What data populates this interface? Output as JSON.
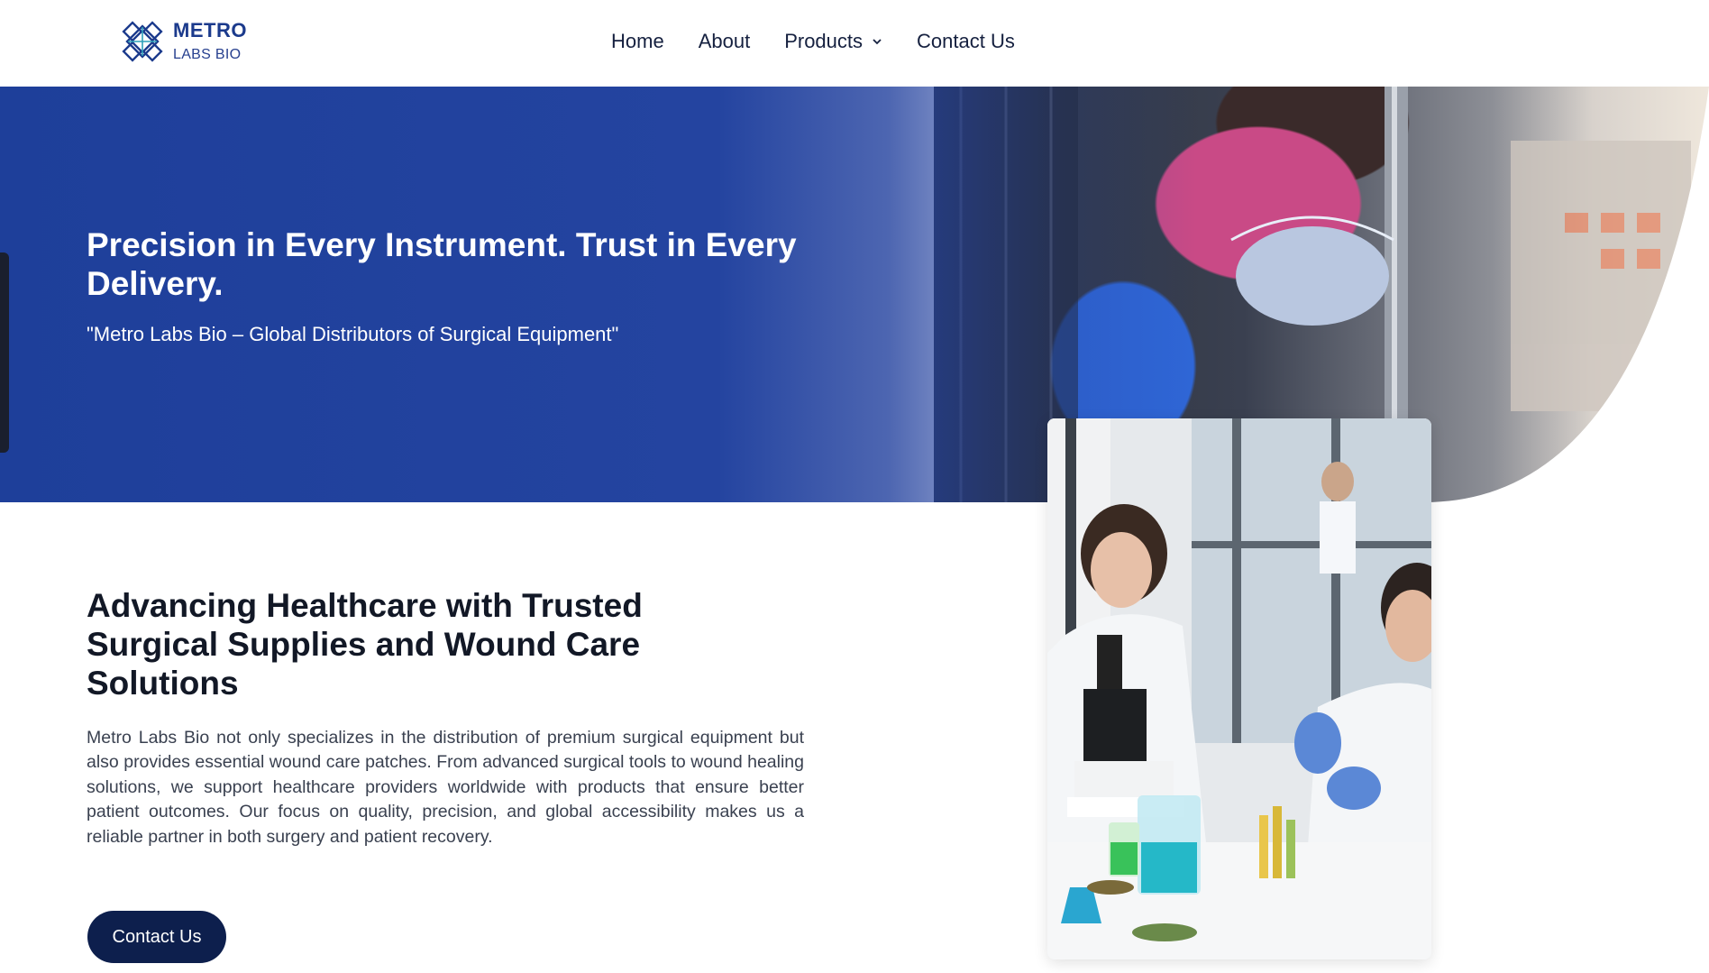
{
  "brand": {
    "name_line1": "METRO",
    "name_line2": "LABS BIO",
    "logo_icon": "lattice-logo-icon",
    "color": "#1b3a8c"
  },
  "nav": {
    "items": [
      {
        "label": "Home"
      },
      {
        "label": "About"
      },
      {
        "label": "Products",
        "icon": "chevron-down-icon"
      },
      {
        "label": "Contact Us"
      }
    ]
  },
  "hero": {
    "title": "Precision in Every Instrument. Trust in Every Delivery.",
    "subtitle": "\"Metro Labs Bio – Global Distributors of Surgical Equipment\"",
    "overlay_color": "#2444a0"
  },
  "content": {
    "title": "Advancing Healthcare with Trusted Surgical Supplies and Wound Care Solutions",
    "body": "Metro Labs Bio not only specializes in the distribution of premium surgical equipment but also provides essential wound care patches. From advanced surgical tools to wound healing solutions, we support healthcare providers worldwide with products that ensure better patient outcomes. Our focus on quality, precision, and global accessibility makes us a reliable partner in both surgery and patient recovery.",
    "cta_label": "Contact Us",
    "cta_color": "#0d1f4d"
  }
}
